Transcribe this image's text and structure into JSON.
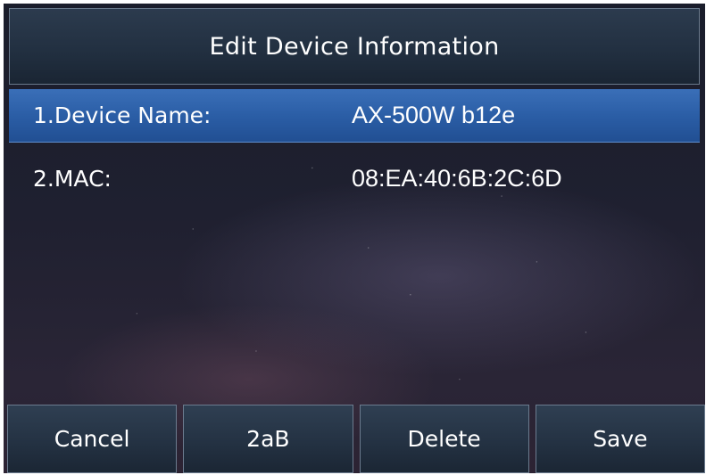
{
  "title": "Edit Device Information",
  "fields": [
    {
      "label": "1.Device Name:",
      "value": "AX-500W b12e",
      "selected": true
    },
    {
      "label": "2.MAC:",
      "value": "08:EA:40:6B:2C:6D",
      "selected": false
    }
  ],
  "softkeys": {
    "cancel": "Cancel",
    "input_mode": "2aB",
    "delete": "Delete",
    "save": "Save"
  },
  "colors": {
    "selected_row": "#2b5ea6",
    "title_bar": "#223041",
    "text": "#ffffff"
  }
}
